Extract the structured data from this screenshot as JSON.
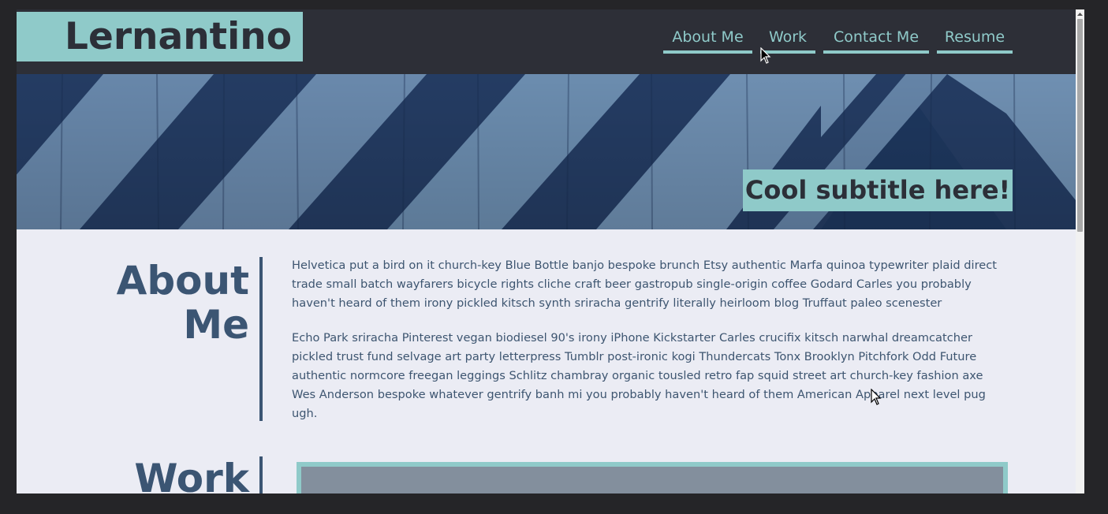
{
  "site": {
    "logo": "Lernantino",
    "nav": [
      {
        "label": "About Me"
      },
      {
        "label": "Work"
      },
      {
        "label": "Contact Me"
      },
      {
        "label": "Resume"
      }
    ],
    "hero": {
      "subtitle": "Cool subtitle here!"
    }
  },
  "about": {
    "title_line1": "About",
    "title_line2": "Me",
    "paragraph1": "Helvetica put a bird on it church-key Blue Bottle banjo bespoke brunch Etsy authentic Marfa quinoa typewriter plaid direct trade small batch wayfarers bicycle rights cliche craft beer gastropub single-origin coffee Godard Carles you probably haven't heard of them irony pickled kitsch synth sriracha gentrify literally heirloom blog Truffaut paleo scenester",
    "paragraph2": "Echo Park sriracha Pinterest vegan biodiesel 90's irony iPhone Kickstarter Carles crucifix kitsch narwhal dreamcatcher pickled trust fund selvage art party letterpress Tumblr post-ironic kogi Thundercats Tonx Brooklyn Pitchfork Odd Future authentic normcore freegan leggings Schlitz chambray organic tousled retro fap squid street art church-key fashion axe Wes Anderson bespoke whatever gentrify banh mi you probably haven't heard of them American Apparel next level pug ugh."
  },
  "work": {
    "title": "Work"
  },
  "colors": {
    "teal": "#8fcac9",
    "header_bg": "#2d2f37",
    "page_bg": "#ebecf4",
    "heading": "#3b5573",
    "text": "#3d5570"
  },
  "icons": [
    "mouse-pointer-icon",
    "scroll-up-arrow-icon"
  ]
}
